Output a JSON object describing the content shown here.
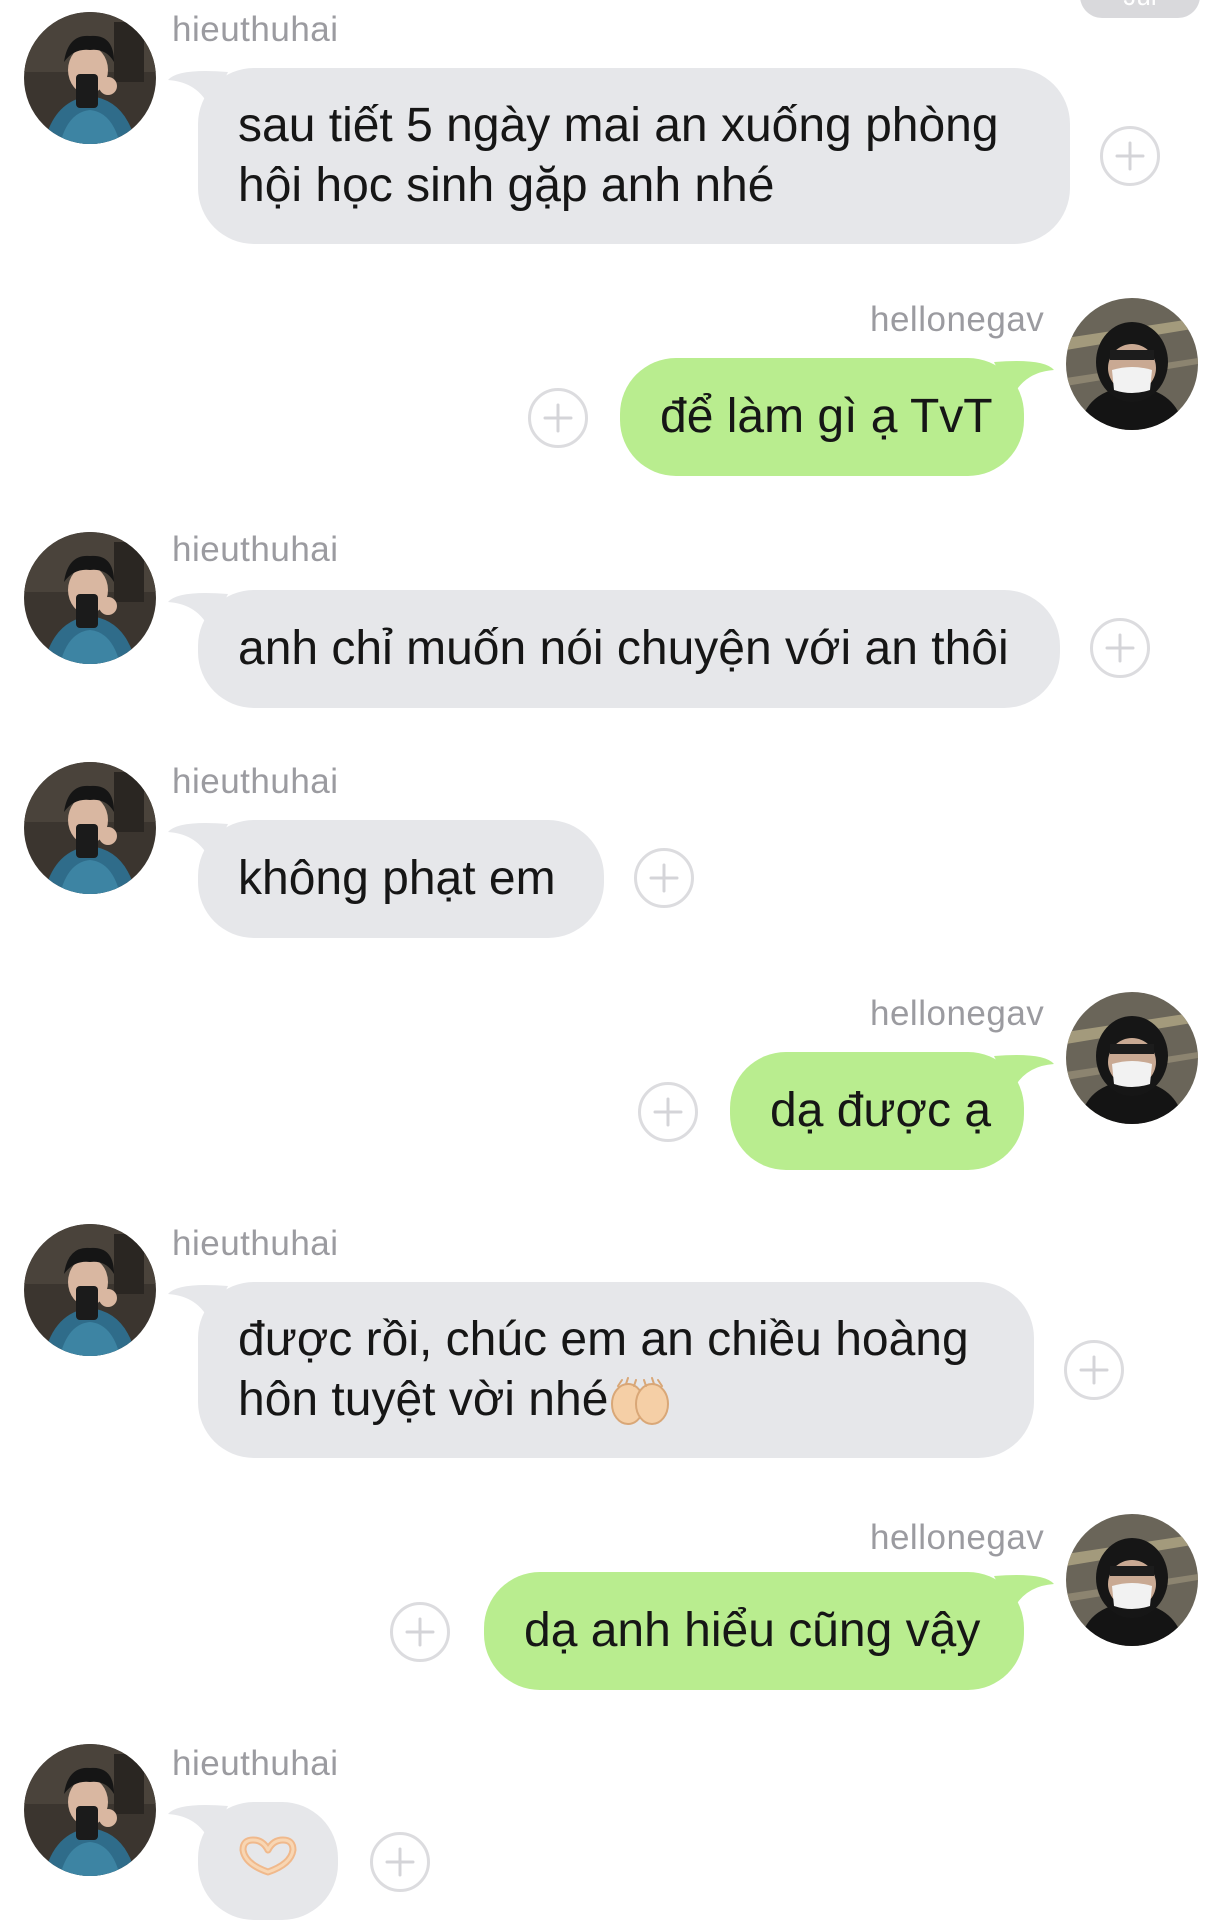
{
  "date_pill": "Jul",
  "users": {
    "incoming": "hieuthuhai",
    "outgoing": "hellonegav"
  },
  "messages": [
    {
      "sender": "hieuthuhai",
      "lines": [
        "sau tiết 5 ngày mai an xuống phòng",
        "hội học sinh gặp anh nhé"
      ]
    },
    {
      "sender": "hellonegav",
      "lines": [
        "để làm gì ạ TvT"
      ]
    },
    {
      "sender": "hieuthuhai",
      "lines": [
        "anh chỉ muốn nói chuyện với an thôi"
      ]
    },
    {
      "sender": "hieuthuhai",
      "lines": [
        "không phạt em"
      ]
    },
    {
      "sender": "hellonegav",
      "lines": [
        "dạ được ạ"
      ]
    },
    {
      "sender": "hieuthuhai",
      "lines": [
        "được rồi, chúc em an chiều hoàng",
        "hôn tuyệt vời nhé"
      ],
      "trailing_emoji": "raising-hands-emoji"
    },
    {
      "sender": "hellonegav",
      "lines": [
        "dạ anh hiểu cũng vậy"
      ]
    },
    {
      "sender": "hieuthuhai",
      "lines": [],
      "emoji": "heart-hands-emoji"
    }
  ],
  "colors": {
    "incoming_bubble": "#e6e7ea",
    "outgoing_bubble": "#b9ed8f",
    "username": "#9b9ba0",
    "add_button_border": "#dcdcdf"
  },
  "icons": {
    "reaction_button": "plus-circle-icon"
  }
}
